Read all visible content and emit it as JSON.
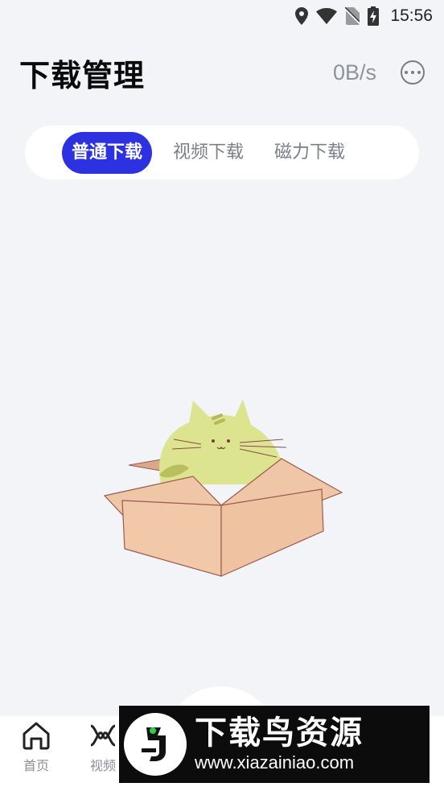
{
  "status_bar": {
    "time": "15:56",
    "icons": [
      "location-icon",
      "wifi-icon",
      "no-sim-icon",
      "battery-charging-icon"
    ]
  },
  "header": {
    "title": "下载管理",
    "speed": "0B/s",
    "more_icon": "more-dots-icon"
  },
  "tabs": [
    {
      "label": "普通下载",
      "active": true
    },
    {
      "label": "视频下载",
      "active": false
    },
    {
      "label": "磁力下载",
      "active": false
    }
  ],
  "colors": {
    "accent": "#2d32e0",
    "background": "#f2f4f8",
    "tab_inactive": "#7b8088"
  },
  "empty_state": {
    "illustration": "cat-in-box"
  },
  "bottom_nav": {
    "items": [
      {
        "label": "首页",
        "icon": "home-icon"
      },
      {
        "label": "视频",
        "icon": "video-icon"
      }
    ]
  },
  "watermark": {
    "title": "下载鸟资源",
    "url": "www.xiazainiao.com"
  }
}
